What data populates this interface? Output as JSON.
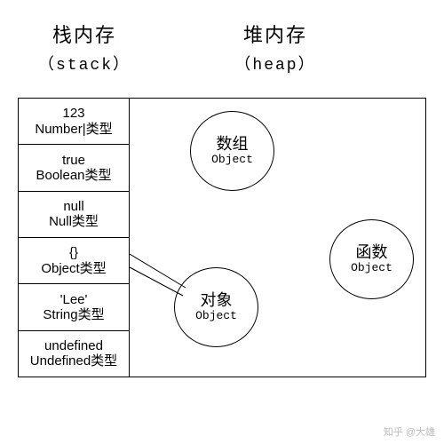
{
  "titles": {
    "stack": "栈内存",
    "stack_sub": "（stack）",
    "heap": "堆内存",
    "heap_sub": "（heap）"
  },
  "stack": [
    {
      "value": "123",
      "type": "Number|类型"
    },
    {
      "value": "true",
      "type": "Boolean类型"
    },
    {
      "value": "null",
      "type": "Null类型"
    },
    {
      "value": "{}",
      "type": "Object类型"
    },
    {
      "value": "'Lee'",
      "type": "String类型"
    },
    {
      "value": "undefined",
      "type": "Undefined类型"
    }
  ],
  "heap": {
    "c1": {
      "name": "数组",
      "type": "Object"
    },
    "c2": {
      "name": "对象",
      "type": "Object"
    },
    "c3": {
      "name": "函数",
      "type": "Object"
    }
  },
  "watermark": "知乎 @大雄"
}
